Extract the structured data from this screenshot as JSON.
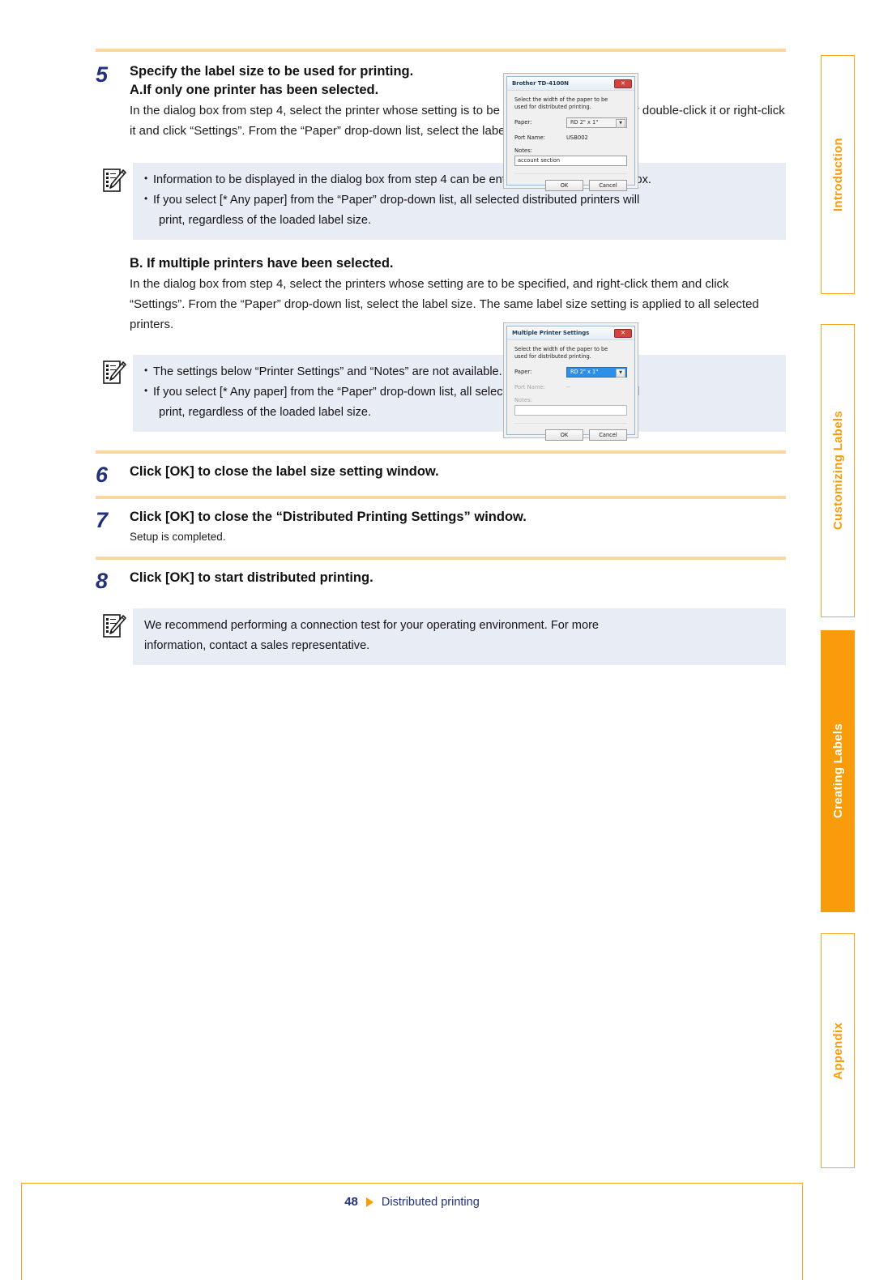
{
  "page": {
    "number": "48",
    "footer_link": "Distributed printing"
  },
  "steps": [
    {
      "number": "5",
      "title": "Specify the label size to be used for printing.",
      "subtitle": "A.If only one printer has been selected.",
      "body": "In the dialog box from step 4, select the printer whose setting is to be specified, and then either double-click it or right-click it and click “Settings”. From the “Paper” drop-down list, select the label size."
    },
    {
      "number": "6",
      "title": "Click [OK] to close the label size setting window."
    },
    {
      "number": "7",
      "title": "Click [OK] to close the “Distributed Printing Settings” window.",
      "body": "Setup is completed."
    },
    {
      "number": "8",
      "title": "Click [OK] to start distributed printing."
    }
  ],
  "section_b": {
    "heading": "B. If multiple printers have been selected.",
    "body": "In the dialog box from step 4, select the printers whose setting are to be specified, and right-click them and click “Settings”. From the “Paper” drop-down list, select the label size. The same label size setting is applied to all selected printers."
  },
  "notes": [
    {
      "id": "note-1",
      "lines": [
        "Information to be displayed in the dialog box from step 4 can be entered in the “Notes” text box.",
        "If you select [* Any paper] from the “Paper” drop-down list, all selected distributed printers will",
        "print, regardless of the loaded label size."
      ]
    },
    {
      "id": "note-2",
      "lines": [
        "The settings below “Printer Settings” and “Notes” are not available.",
        "If you select [* Any paper] from the “Paper” drop-down list, all selected distributed printers will",
        "print, regardless of the loaded label size."
      ]
    },
    {
      "id": "note-3",
      "lines": [
        "We recommend performing a connection test for your operating environment. For more",
        "information, contact a sales representative."
      ]
    }
  ],
  "dialog_single": {
    "title": "Brother TD-4100N",
    "close_glyph": "✕",
    "description": "Select the width of the paper to be used for distributed printing.",
    "paper_label": "Paper:",
    "paper_value": "RD 2\" x 1\"",
    "port_label": "Port Name:",
    "port_value": "USB002",
    "notes_label": "Notes:",
    "notes_value": "account section",
    "ok_label": "OK",
    "cancel_label": "Cancel"
  },
  "dialog_multiple": {
    "title": "Multiple Printer Settings",
    "close_glyph": "✕",
    "description": "Select the width of the paper to be used for distributed printing.",
    "paper_label": "Paper:",
    "paper_value": "RD 2\" x 1\"",
    "port_label": "Port Name:",
    "port_value": "--",
    "notes_label": "Notes:",
    "notes_value": "",
    "ok_label": "OK",
    "cancel_label": "Cancel"
  },
  "tabs": [
    {
      "label": "Introduction",
      "active": false
    },
    {
      "label": "Customizing Labels",
      "active": false
    },
    {
      "label": "Creating Labels",
      "active": true
    },
    {
      "label": "Appendix",
      "active": false
    }
  ],
  "colors": {
    "accent_orange": "#f99c0b",
    "rule_orange": "#fbd6a0",
    "heading_blue": "#22317a",
    "note_bg": "#e8ecf5"
  }
}
